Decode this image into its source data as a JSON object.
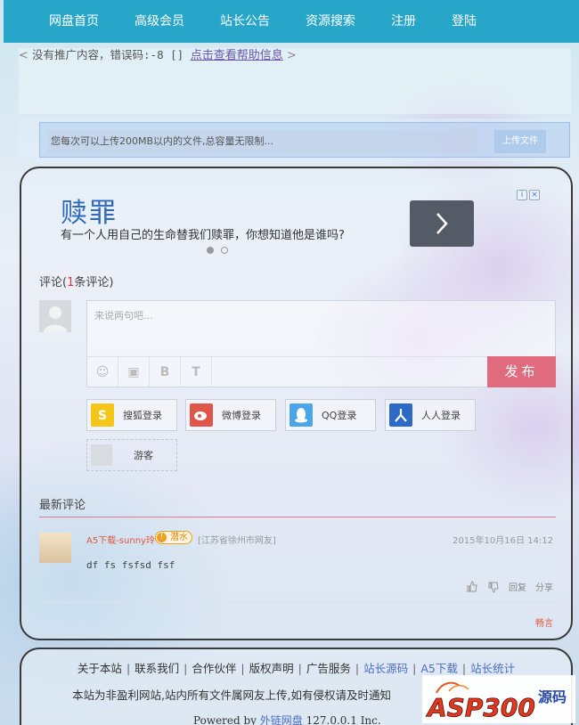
{
  "nav": {
    "items": [
      "网盘首页",
      "高级会员",
      "站长公告",
      "资源搜索",
      "注册",
      "登陆"
    ]
  },
  "ad_notice": {
    "open_bracket": "<",
    "message": "没有推广内容，错误码:-8 [] ",
    "link": "点击查看帮助信息",
    "close_bracket": ">"
  },
  "upload": {
    "placeholder": "您每次可以上传200MB以内的文件,总容量无限制...",
    "button": "上传文件"
  },
  "banner": {
    "title": "赎罪",
    "subtitle": "有一个人用自己的生命替我们赎罪，你想知道他是谁吗?"
  },
  "comments": {
    "heading_prefix": "评论(",
    "count": "1",
    "heading_suffix": "条评论)",
    "placeholder": "来说两句吧...",
    "publish": "发布",
    "tools": [
      "☺",
      "▣",
      "B",
      "T"
    ],
    "logins": [
      {
        "label": "搜狐登录",
        "icon": "sohu-icon",
        "color": "#f5c518"
      },
      {
        "label": "微博登录",
        "icon": "weibo-icon",
        "color": "#e0564b"
      },
      {
        "label": "QQ登录",
        "icon": "qq-icon",
        "color": "#4aa6e8"
      },
      {
        "label": "人人登录",
        "icon": "renren-icon",
        "color": "#2d6ac8"
      }
    ],
    "guest": "游客",
    "latest_title": "最新评论",
    "items": [
      {
        "user": "A5下载-sunny玲",
        "badge": "潜水",
        "location": "[江苏省徐州市网友]",
        "time": "2015年10月16日 14:12",
        "text": "df fs fsfsd fsf",
        "reply": "回复",
        "share": "分享"
      }
    ],
    "powered": "畅言"
  },
  "footer": {
    "links": [
      "关于本站",
      "联系我们",
      "合作伙伴",
      "版权声明",
      "广告服务",
      "站长源码",
      "A5下载",
      "站长统计"
    ],
    "notice": "本站为非盈利网站,站内所有文件属网友上传,如有侵权请及时通知",
    "powered_prefix": "Powered by ",
    "powered_link": "外链网盘",
    "powered_suffix": " 127.0.0.1 Inc."
  },
  "watermark": {
    "text": "ASP300",
    "text2": "源码"
  }
}
